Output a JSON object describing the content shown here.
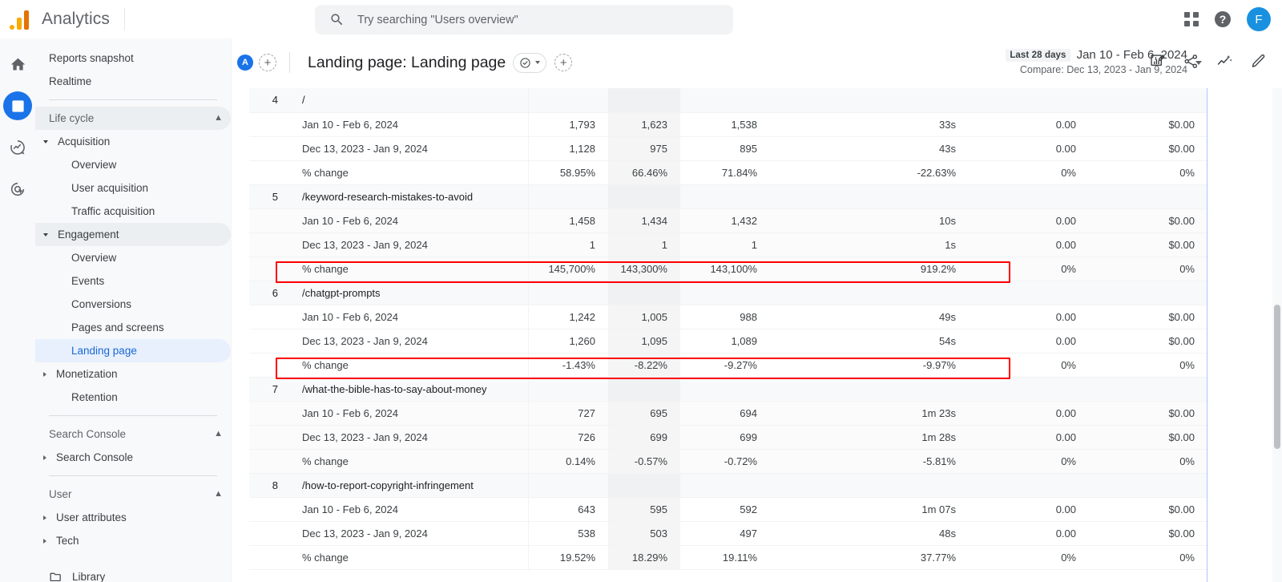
{
  "topbar": {
    "brand": "Analytics",
    "search": {
      "placeholder": "Try searching \"Users overview\"",
      "value": ""
    },
    "apps_icon": "apps-grid-icon",
    "help_icon": "help-icon",
    "help_label": "?",
    "avatar_initial": "F"
  },
  "rail": {
    "items": [
      {
        "name": "home-icon",
        "label": "Home",
        "active": false
      },
      {
        "name": "reports-icon",
        "label": "Reports",
        "active": true
      },
      {
        "name": "explore-icon",
        "label": "Explore",
        "active": false
      },
      {
        "name": "advertising-icon",
        "label": "Advertising",
        "active": false
      }
    ]
  },
  "sidebar": {
    "items": [
      {
        "label": "Reports snapshot",
        "type": "plain",
        "state": "normal"
      },
      {
        "label": "Realtime",
        "type": "plain",
        "state": "normal"
      },
      {
        "label": "Life cycle",
        "type": "group",
        "state": "highlight",
        "collapse_icon": "chevron-up-icon"
      },
      {
        "label": "Acquisition",
        "type": "expandable-open",
        "state": "normal"
      },
      {
        "label": "Overview",
        "type": "child",
        "state": "normal"
      },
      {
        "label": "User acquisition",
        "type": "child",
        "state": "normal"
      },
      {
        "label": "Traffic acquisition",
        "type": "child",
        "state": "normal"
      },
      {
        "label": "Engagement",
        "type": "expandable-open",
        "state": "highlight"
      },
      {
        "label": "Overview",
        "type": "child",
        "state": "normal"
      },
      {
        "label": "Events",
        "type": "child",
        "state": "normal"
      },
      {
        "label": "Conversions",
        "type": "child",
        "state": "normal"
      },
      {
        "label": "Pages and screens",
        "type": "child",
        "state": "normal"
      },
      {
        "label": "Landing page",
        "type": "child",
        "state": "active"
      },
      {
        "label": "Monetization",
        "type": "expandable-closed",
        "state": "normal"
      },
      {
        "label": "Retention",
        "type": "child",
        "state": "normal"
      },
      {
        "label": "Search Console",
        "type": "group",
        "state": "normal",
        "collapse_icon": "chevron-up-icon"
      },
      {
        "label": "Search Console",
        "type": "expandable-closed",
        "state": "normal"
      },
      {
        "label": "User",
        "type": "group",
        "state": "normal",
        "collapse_icon": "chevron-up-icon"
      },
      {
        "label": "User attributes",
        "type": "expandable-closed",
        "state": "normal"
      },
      {
        "label": "Tech",
        "type": "expandable-closed",
        "state": "normal"
      },
      {
        "label": "Library",
        "type": "library",
        "state": "normal",
        "icon": "folder-icon"
      }
    ]
  },
  "report_header": {
    "audience_chip": "A",
    "add_comparison_label": "+",
    "title": "Landing page: Landing page",
    "check_icon": "check-circle-icon",
    "caret_icon": "chevron-down-icon",
    "add_icon": "plus-icon",
    "date": {
      "badge": "Last 28 days",
      "range": "Jan 10 - Feb 6, 2024",
      "compare": "Compare: Dec 13, 2023 - Jan 9, 2024"
    },
    "actions": [
      {
        "name": "customize-report-icon",
        "label": "Customize report"
      },
      {
        "name": "share-icon",
        "label": "Share this report"
      },
      {
        "name": "insights-icon",
        "label": "Insights"
      },
      {
        "name": "edit-icon",
        "label": "Edit"
      }
    ]
  },
  "table": {
    "date_primary": "Jan 10 - Feb 6, 2024",
    "date_compare": "Dec 13, 2023 - Jan 9, 2024",
    "change_label": "% change",
    "groups": [
      {
        "rank": "4",
        "path": "/",
        "rows": [
          {
            "label": "Jan 10 - Feb 6, 2024",
            "values": [
              "1,793",
              "1,623",
              "1,538",
              "33s",
              "0.00",
              "$0.00"
            ]
          },
          {
            "label": "Dec 13, 2023 - Jan 9, 2024",
            "values": [
              "1,128",
              "975",
              "895",
              "43s",
              "0.00",
              "$0.00"
            ]
          },
          {
            "label": "% change",
            "values": [
              "58.95%",
              "66.46%",
              "71.84%",
              "-22.63%",
              "0%",
              "0%"
            ]
          }
        ]
      },
      {
        "rank": "5",
        "path": "/keyword-research-mistakes-to-avoid",
        "rows": [
          {
            "label": "Jan 10 - Feb 6, 2024",
            "values": [
              "1,458",
              "1,434",
              "1,432",
              "10s",
              "0.00",
              "$0.00"
            ]
          },
          {
            "label": "Dec 13, 2023 - Jan 9, 2024",
            "values": [
              "1",
              "1",
              "1",
              "1s",
              "0.00",
              "$0.00"
            ]
          },
          {
            "label": "% change",
            "values": [
              "145,700%",
              "143,300%",
              "143,100%",
              "919.2%",
              "0%",
              "0%"
            ],
            "highlighted": true
          }
        ]
      },
      {
        "rank": "6",
        "path": "/chatgpt-prompts",
        "rows": [
          {
            "label": "Jan 10 - Feb 6, 2024",
            "values": [
              "1,242",
              "1,005",
              "988",
              "49s",
              "0.00",
              "$0.00"
            ]
          },
          {
            "label": "Dec 13, 2023 - Jan 9, 2024",
            "values": [
              "1,260",
              "1,095",
              "1,089",
              "54s",
              "0.00",
              "$0.00"
            ]
          },
          {
            "label": "% change",
            "values": [
              "-1.43%",
              "-8.22%",
              "-9.27%",
              "-9.97%",
              "0%",
              "0%"
            ],
            "highlighted": true
          }
        ]
      },
      {
        "rank": "7",
        "path": "/what-the-bible-has-to-say-about-money",
        "rows": [
          {
            "label": "Jan 10 - Feb 6, 2024",
            "values": [
              "727",
              "695",
              "694",
              "1m 23s",
              "0.00",
              "$0.00"
            ]
          },
          {
            "label": "Dec 13, 2023 - Jan 9, 2024",
            "values": [
              "726",
              "699",
              "699",
              "1m 28s",
              "0.00",
              "$0.00"
            ]
          },
          {
            "label": "% change",
            "values": [
              "0.14%",
              "-0.57%",
              "-0.72%",
              "-5.81%",
              "0%",
              "0%"
            ]
          }
        ]
      },
      {
        "rank": "8",
        "path": "/how-to-report-copyright-infringement",
        "rows": [
          {
            "label": "Jan 10 - Feb 6, 2024",
            "values": [
              "643",
              "595",
              "592",
              "1m 07s",
              "0.00",
              "$0.00"
            ]
          },
          {
            "label": "Dec 13, 2023 - Jan 9, 2024",
            "values": [
              "538",
              "503",
              "497",
              "48s",
              "0.00",
              "$0.00"
            ]
          },
          {
            "label": "% change",
            "values": [
              "19.52%",
              "18.29%",
              "19.11%",
              "37.77%",
              "0%",
              "0%"
            ]
          }
        ]
      }
    ]
  },
  "colors": {
    "accent_blue": "#1a73e8",
    "highlight_red": "#ff0000",
    "sidebar_bg": "#f8f9fa",
    "active_nav": "#e8f0fe"
  }
}
